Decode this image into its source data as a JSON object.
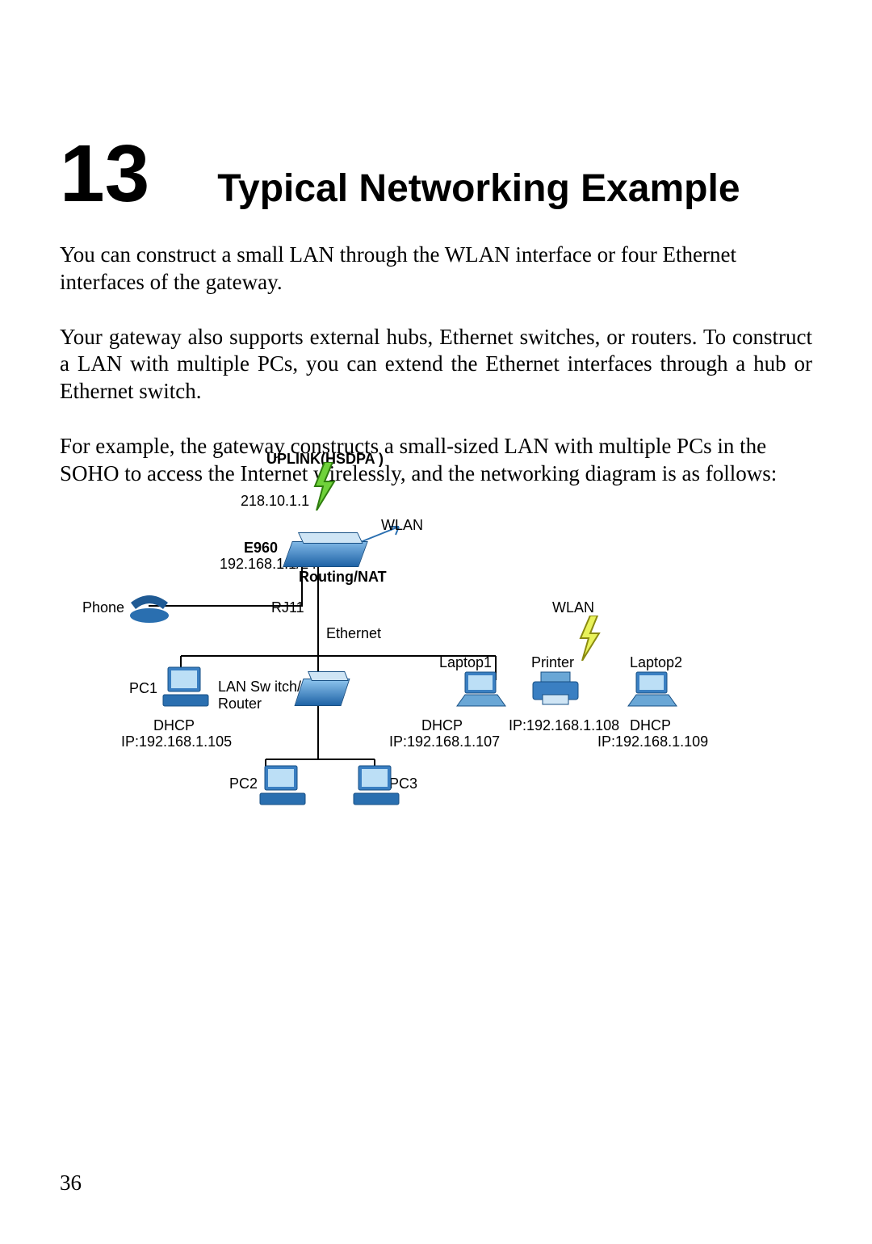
{
  "chapter": {
    "number": "13",
    "title": "Typical Networking Example"
  },
  "paragraphs": {
    "p1": "You can construct a small LAN through the WLAN interface or four Ethernet interfaces of the gateway.",
    "p2": "Your gateway also supports external hubs, Ethernet switches, or routers. To construct a LAN with multiple PCs, you can extend the Ethernet interfaces through a hub or Ethernet switch.",
    "p3": "For example, the gateway constructs a small-sized LAN with multiple PCs in the SOHO to access the Internet wirelessly, and the networking diagram is as follows:"
  },
  "diagram": {
    "uplink": "UPLINK(HSDPA   )",
    "wan_ip": "218.10.1.1",
    "device": "E960",
    "lan_ip": "192.168.1.1/24",
    "routing": "Routing/NAT",
    "wlan1": "WLAN",
    "wlan2": "WLAN",
    "phone": "Phone",
    "rj11": "RJ11",
    "ethernet": "Ethernet",
    "pc1": {
      "name": "PC1",
      "dhcp": "DHCP",
      "ip": "IP:192.168.1.105"
    },
    "lan_switch": "LAN Sw itch/\nRouter",
    "laptop1": {
      "name": "Laptop1",
      "dhcp": "DHCP",
      "ip": "IP:192.168.1.107"
    },
    "printer": {
      "name": "Printer",
      "ip": "IP:192.168.1.108"
    },
    "laptop2": {
      "name": "Laptop2",
      "dhcp": "DHCP",
      "ip": "IP:192.168.1.109"
    },
    "pc2": "PC2",
    "pc3": "PC3"
  },
  "page_number": "36"
}
